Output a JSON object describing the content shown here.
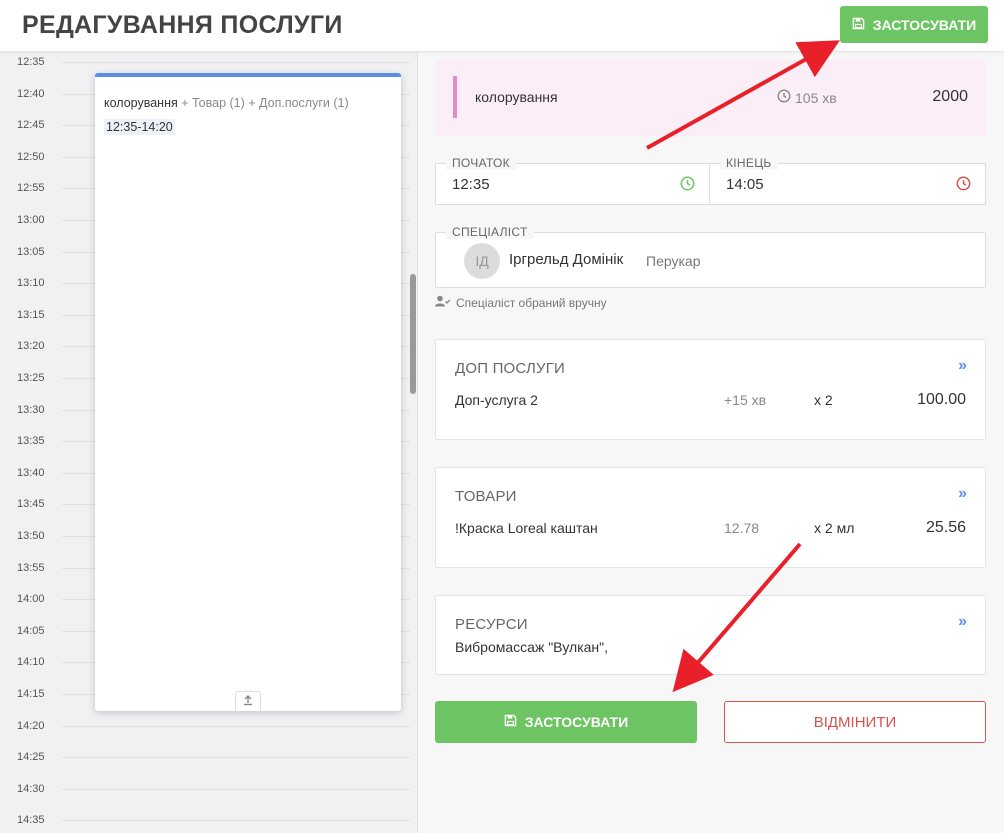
{
  "header": {
    "title": "РЕДАГУВАННЯ ПОСЛУГИ",
    "apply_label": "ЗАСТОСУВАТИ"
  },
  "calendar": {
    "times": [
      "12:35",
      "12:40",
      "12:45",
      "12:50",
      "12:55",
      "13:00",
      "13:05",
      "13:10",
      "13:15",
      "13:20",
      "13:25",
      "13:30",
      "13:35",
      "13:40",
      "13:45",
      "13:50",
      "13:55",
      "14:00",
      "14:05",
      "14:10",
      "14:15",
      "14:20",
      "14:25",
      "14:30",
      "14:35"
    ],
    "event": {
      "service": "колорування",
      "extras": " + Товар (1) + Доп.послуги (1)",
      "time_range": "12:35-14:20"
    }
  },
  "service": {
    "name": "колорування",
    "duration": "105 хв",
    "price": "2000"
  },
  "start": {
    "label": "ПОЧАТОК",
    "value": "12:35"
  },
  "end": {
    "label": "КІНЕЦЬ",
    "value": "14:05"
  },
  "specialist": {
    "label": "СПЕЦІАЛІСТ",
    "initials": "ІД",
    "name": "Іргрельд Домінік",
    "role": "Перукар",
    "note": "Спеціаліст обраний вручну"
  },
  "extras_card": {
    "title": "ДОП ПОСЛУГИ",
    "item": {
      "name": "Доп-услуга 2",
      "time": "+15 хв",
      "qty": "x 2",
      "total": "100.00"
    }
  },
  "goods_card": {
    "title": "ТОВАРИ",
    "item": {
      "name": "!Краска Loreal каштан",
      "price": "12.78",
      "qty": "x 2 мл",
      "total": "25.56"
    }
  },
  "resources_card": {
    "title": "РЕСУРСИ",
    "value": "Вибромассаж \"Вулкан\","
  },
  "actions": {
    "apply_label": "ЗАСТОСУВАТИ",
    "cancel_label": "ВІДМІНИТИ"
  },
  "colors": {
    "green": "#6cc462",
    "red": "#d9534f",
    "blue": "#5b8fde",
    "pink_bg": "#fceef6"
  }
}
